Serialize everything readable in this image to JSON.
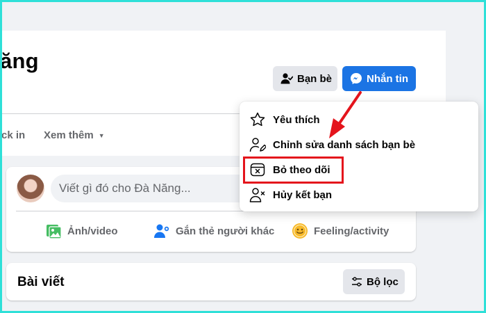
{
  "profile": {
    "name": "ăng"
  },
  "actions": {
    "friends_label": "Bạn bè",
    "message_label": "Nhắn tin"
  },
  "tabs": [
    {
      "label": "ck in"
    },
    {
      "label": "Xem thêm"
    }
  ],
  "composer": {
    "placeholder": "Viết gì đó cho Đà Năng...",
    "photo_label": "Ảnh/video",
    "tag_label": "Gắn thẻ người khác",
    "feeling_label": "Feeling/activity"
  },
  "posts": {
    "title": "Bài viết",
    "filter_label": "Bộ lọc"
  },
  "dropdown": {
    "items": [
      {
        "label": "Yêu thích",
        "icon": "star-icon"
      },
      {
        "label": "Chỉnh sửa danh sách bạn bè",
        "icon": "edit-friend-list-icon"
      },
      {
        "label": "Bỏ theo dõi",
        "icon": "unfollow-icon"
      },
      {
        "label": "Hủy kết bạn",
        "icon": "unfriend-icon"
      }
    ]
  },
  "colors": {
    "accent": "#1b74e4",
    "annotation": "#e4141c",
    "frame": "#2ee0d8"
  }
}
